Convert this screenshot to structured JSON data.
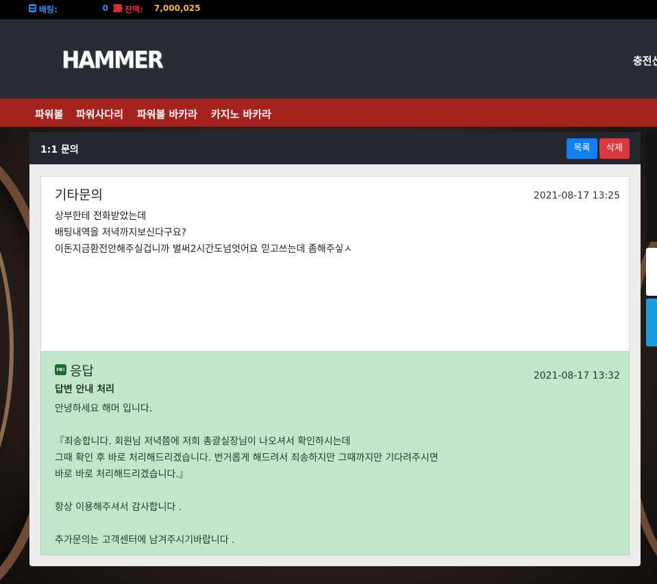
{
  "topbar": {
    "bet_label": "배팅:",
    "bet_value": "0",
    "balance_label": "잔액:",
    "balance_value": "7,000,025"
  },
  "header": {
    "logo_text": "HAMMER",
    "charge_link": "충전신"
  },
  "nav": {
    "items": [
      "파워볼",
      "파워사다리",
      "파워볼 바카라",
      "카지노 바카라"
    ]
  },
  "card": {
    "title": "1:1 문의",
    "list_button": "목록",
    "delete_button": "삭제"
  },
  "question": {
    "title": "기타문의",
    "date": "2021-08-17 13:25",
    "lines": [
      "상부한테 전화받았는데",
      "배팅내역을 저녁까지보신다구요?",
      "이돈지금환전안해주실겁니까 벌써2시간도넘엇어요 믿고쓰는데 좀해주싷ㅅ"
    ]
  },
  "answer": {
    "badge": "re:",
    "title": "응답",
    "date": "2021-08-17 13:32",
    "subtitle": "답변 안내 처리",
    "lines": [
      "안녕하세요 해머 입니다.",
      "『죄송합니다. 회원님 저녁쯤에 저희 총괄실장님이 나오셔서 확인하시는데",
      "그때 확인 후 바로 처리해드리겠습니다. 번거롭게 해드려서 죄송하지만 그때까지만 기다려주시면",
      "바로 바로 처리해드리겠습니다.』",
      "항상 이용해주셔서 감사합니다 .",
      "추가문의는 고객센터에 남겨주시기바랍니다 ."
    ]
  },
  "colors": {
    "nav_red": "#a6221e",
    "header_dark": "#282c35",
    "answer_green": "#c4e6cc",
    "button_blue": "#1480ef",
    "button_red": "#d9383e",
    "balance_gold": "#f1b64a"
  }
}
